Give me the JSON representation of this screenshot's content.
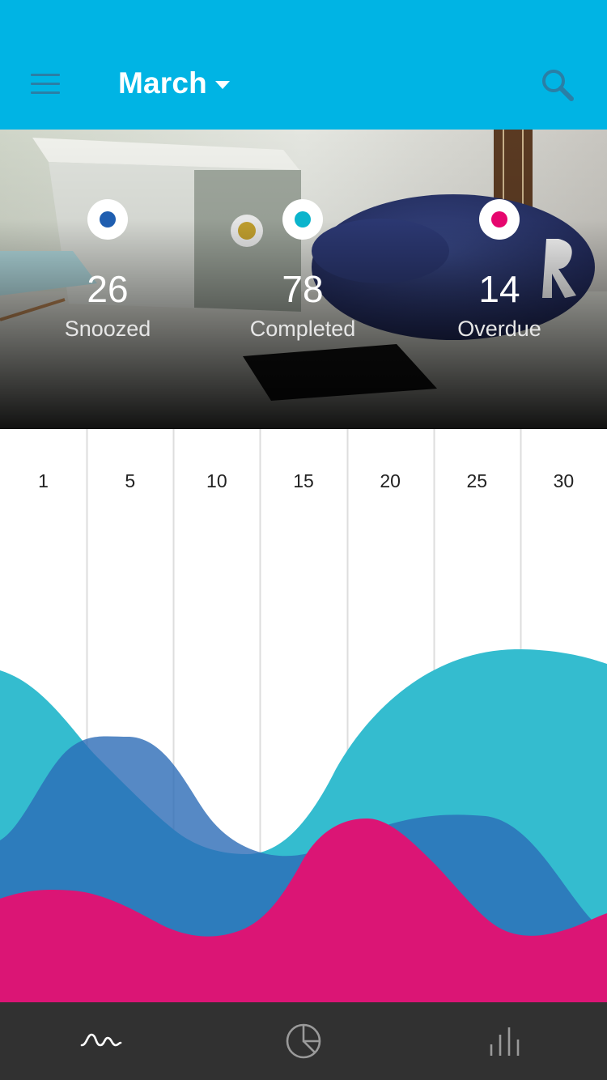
{
  "appbar": {
    "title": "March",
    "menu_icon": "hamburger-menu-icon",
    "dropdown_icon": "caret-down-icon",
    "search_icon": "search-icon",
    "background_color": "#00b4e4",
    "menu_icon_color": "#2a7fa6"
  },
  "stats": [
    {
      "value": "26",
      "label": "Snoozed",
      "color": "#1f5eb0"
    },
    {
      "value": "78",
      "label": "Completed",
      "color": "#0bb4cc"
    },
    {
      "value": "14",
      "label": "Overdue",
      "color": "#e6066e"
    }
  ],
  "chart_data": {
    "type": "area",
    "x_ticks": [
      "1",
      "5",
      "10",
      "15",
      "20",
      "25",
      "30"
    ],
    "series": [
      {
        "color": "#34bccf"
      },
      {
        "color": "#2c6cb6"
      },
      {
        "color": "#db1575"
      }
    ],
    "grid": true
  },
  "bottom_nav": {
    "items": [
      {
        "icon": "wave-chart-icon",
        "active": true
      },
      {
        "icon": "pie-chart-icon",
        "active": false
      },
      {
        "icon": "bar-chart-icon",
        "active": false
      }
    ],
    "background_color": "#313131"
  }
}
